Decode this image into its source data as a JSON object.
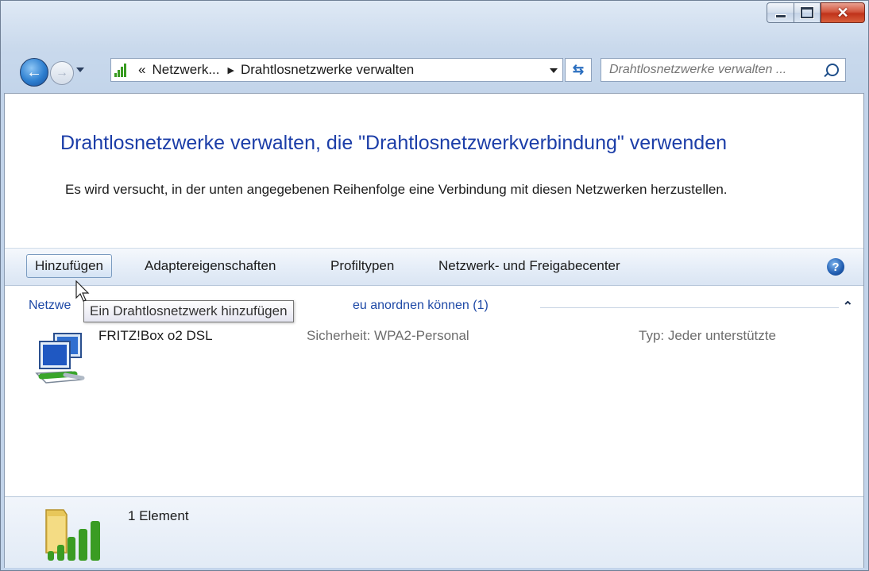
{
  "window": {
    "caption_buttons": [
      "minimize",
      "maximize",
      "close"
    ]
  },
  "navigation": {
    "breadcrumb_prefix": "«",
    "breadcrumb": [
      "Netzwerk...",
      "Drahtlosnetzwerke verwalten"
    ],
    "search_placeholder": "Drahtlosnetzwerke verwalten ..."
  },
  "main": {
    "heading": "Drahtlosnetzwerke verwalten, die \"Drahtlosnetzwerkverbindung\" verwenden",
    "description": "Es wird versucht, in der unten angegebenen Reihenfolge eine Verbindung mit diesen Netzwerken herzustellen."
  },
  "toolbar": {
    "add_label": "Hinzufügen",
    "adapter_label": "Adaptereigenschaften",
    "profile_label": "Profiltypen",
    "center_label": "Netzwerk- und Freigabecenter"
  },
  "group": {
    "header_visible_start": "Netzwe",
    "header_visible_end": "eu anordnen können (1)"
  },
  "networks": [
    {
      "name": "FRITZ!Box o2 DSL",
      "security": "Sicherheit: WPA2-Personal",
      "type": "Typ: Jeder unterstützte"
    }
  ],
  "tooltip": {
    "text": "Ein Drahtlosnetzwerk hinzufügen"
  },
  "status": {
    "count_text": "1 Element"
  },
  "colors": {
    "heading": "#1c3ea8",
    "link_blue": "#1e49a6",
    "close_red": "#c0321a",
    "signal_green": "#3a9c23"
  }
}
